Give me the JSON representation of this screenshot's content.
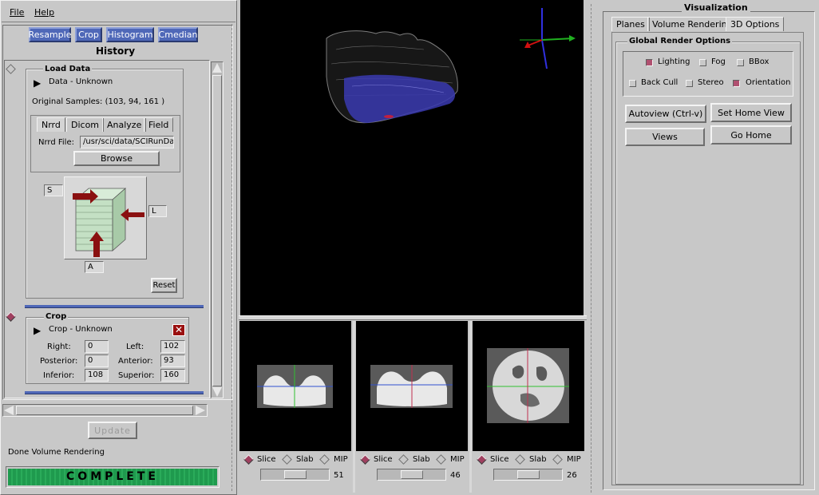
{
  "menu": {
    "file": "File",
    "help": "Help"
  },
  "tools": {
    "resample": "Resample",
    "crop": "Crop",
    "histogram": "Histogram",
    "cmedian": "Cmedian"
  },
  "history_title": "History",
  "load_data": {
    "title": "Load Data",
    "status": "Data - Unknown",
    "samples": "Original Samples: (103, 94, 161 )",
    "tabs": [
      "Nrrd",
      "Dicom",
      "Analyze",
      "Field"
    ],
    "file_label": "Nrrd File:",
    "file_value": "/usr/sci/data/SCIRunData",
    "browse": "Browse",
    "axis_s": "S",
    "axis_l": "L",
    "axis_a": "A",
    "reset": "Reset"
  },
  "crop": {
    "title": "Crop",
    "status": "Crop - Unknown",
    "right_label": "Right:",
    "right": "0",
    "left_label": "Left:",
    "left": "102",
    "posterior_label": "Posterior:",
    "posterior": "0",
    "anterior_label": "Anterior:",
    "anterior": "93",
    "inferior_label": "Inferior:",
    "inferior": "108",
    "superior_label": "Superior:",
    "superior": "160"
  },
  "update": "Update",
  "status_text": "Done Volume Rendering",
  "progress_label": "COMPLETE",
  "progress_fraction": 1.0,
  "slice_views": [
    {
      "slice": "Slice",
      "slab": "Slab",
      "mip": "MIP",
      "value": "51"
    },
    {
      "slice": "Slice",
      "slab": "Slab",
      "mip": "MIP",
      "value": "46"
    },
    {
      "slice": "Slice",
      "slab": "Slab",
      "mip": "MIP",
      "value": "26"
    }
  ],
  "visualization": {
    "title": "Visualization",
    "tabs": [
      "Planes",
      "Volume Rendering",
      "3D Options"
    ],
    "global_title": "Global Render Options",
    "lighting": "Lighting",
    "fog": "Fog",
    "bbox": "BBox",
    "back_cull": "Back Cull",
    "stereo": "Stereo",
    "orientation": "Orientation",
    "autoview": "Autoview (Ctrl-v)",
    "set_home": "Set Home View",
    "views": "Views",
    "go_home": "Go Home"
  },
  "colors": {
    "progress": "#1f9a4e",
    "tool_button": "#4f68b8",
    "volume_blue": "#3a3ab0"
  }
}
